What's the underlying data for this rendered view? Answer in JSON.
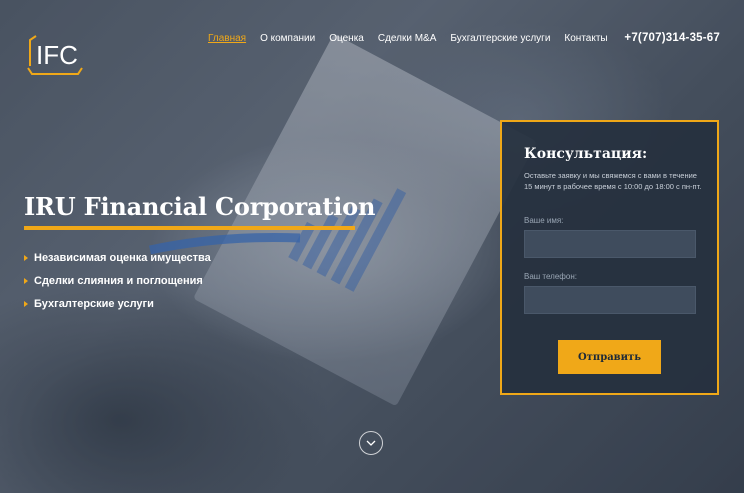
{
  "header": {
    "logo_text": "IFC",
    "nav": [
      {
        "label": "Главная",
        "active": true
      },
      {
        "label": "О компании",
        "active": false
      },
      {
        "label": "Оценка",
        "active": false
      },
      {
        "label": "Сделки M&A",
        "active": false
      },
      {
        "label": "Бухгалтерские услуги",
        "active": false
      },
      {
        "label": "Контакты",
        "active": false
      }
    ],
    "phone": "+7(707)314-35-67"
  },
  "hero": {
    "title": "IRU Financial Corporation",
    "features": [
      "Независимая оценка имущества",
      "Сделки слияния и поглощения",
      "Бухгалтерские услуги"
    ]
  },
  "form": {
    "title": "Консультация:",
    "description": "Оставьте заявку и мы свяжемся с вами в течение 15 минут в рабочее время с 10:00 до 18:00 с пн-пт.",
    "name_label": "Ваше имя:",
    "name_value": "",
    "phone_label": "Ваш телефон:",
    "phone_value": "",
    "submit_label": "Отправить"
  },
  "colors": {
    "accent": "#f0a818",
    "panel_bg": "#26303e",
    "field_bg": "#3f4c5d"
  },
  "icons": {
    "logo": "ifc-logo-icon",
    "bullet": "triangle-bullet-icon",
    "scroll": "chevron-down-icon"
  }
}
